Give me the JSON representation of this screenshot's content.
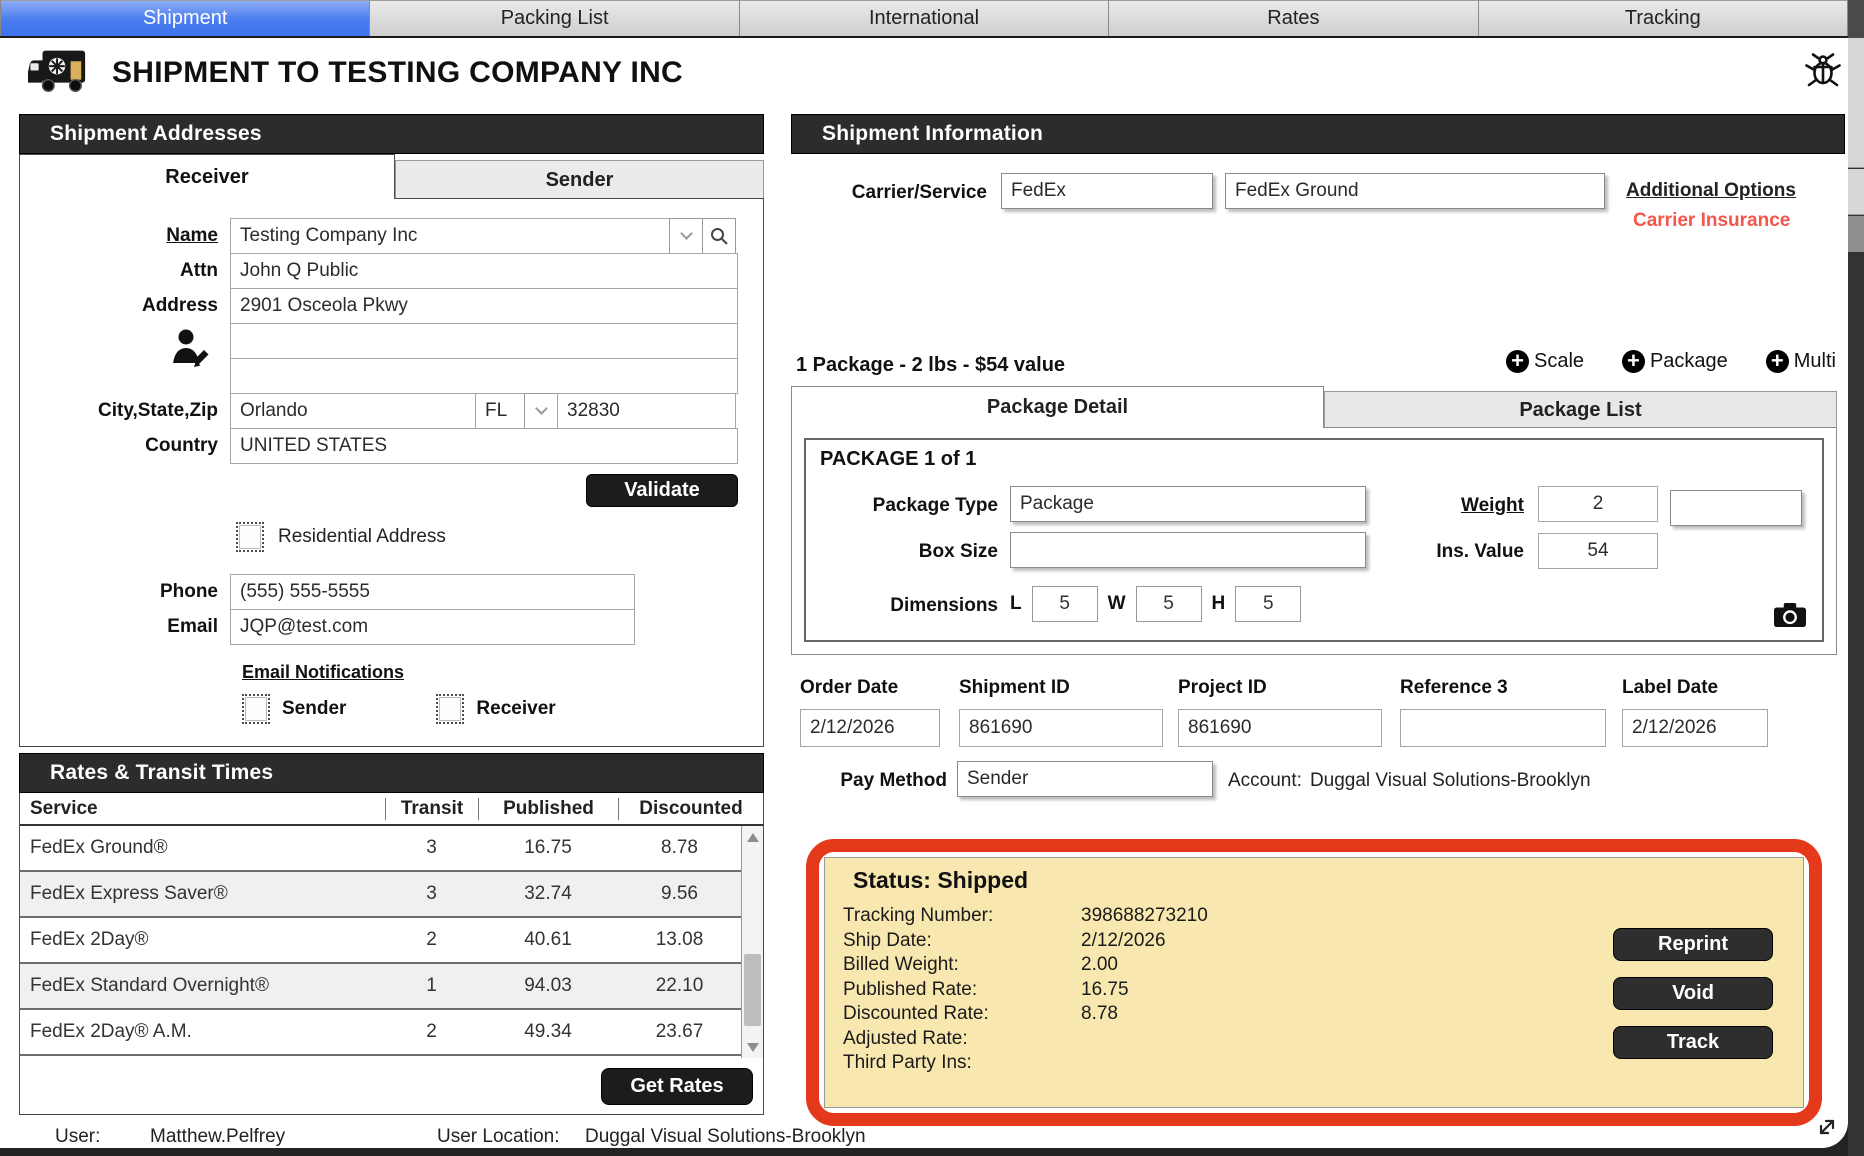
{
  "tab_bar": {
    "items": [
      "Shipment",
      "Packing List",
      "International",
      "Rates",
      "Tracking"
    ]
  },
  "header": {
    "title": "SHIPMENT TO TESTING COMPANY INC"
  },
  "addresses": {
    "title": "Shipment Addresses",
    "receiver_tab": "Receiver",
    "sender_tab": "Sender",
    "name_label": "Name",
    "name": "Testing Company Inc",
    "attn_label": "Attn",
    "attn": "John Q Public",
    "address_label": "Address",
    "address_line1": "2901 Osceola Pkwy",
    "address_line2": "",
    "address_line3": "",
    "city_state_zip_label": "City,State,Zip",
    "city": "Orlando",
    "state": "FL",
    "zip": "32830",
    "country_label": "Country",
    "country": "UNITED STATES",
    "validate_button": "Validate",
    "residential_checkbox_label": "Residential Address",
    "phone_label": "Phone",
    "phone": "(555) 555-5555",
    "email_label": "Email",
    "email": "JQP@test.com",
    "email_notifications_label": "Email Notifications",
    "notify_sender_label": "Sender",
    "notify_receiver_label": "Receiver"
  },
  "rates": {
    "title": "Rates & Transit Times",
    "columns": [
      "Service",
      "Transit",
      "Published",
      "Discounted"
    ],
    "rows": [
      [
        "FedEx Ground®",
        "3",
        "16.75",
        "8.78"
      ],
      [
        "FedEx Express Saver®",
        "3",
        "32.74",
        "9.56"
      ],
      [
        "FedEx 2Day®",
        "2",
        "40.61",
        "13.08"
      ],
      [
        "FedEx Standard Overnight®",
        "1",
        "94.03",
        "22.10"
      ],
      [
        "FedEx 2Day® A.M.",
        "2",
        "49.34",
        "23.67"
      ]
    ],
    "get_rates_button": "Get Rates"
  },
  "shipment_info": {
    "title": "Shipment Information",
    "carrier_service_label": "Carrier/Service",
    "carrier": "FedEx",
    "service": "FedEx Ground",
    "additional_options_link": "Additional Options",
    "carrier_insurance_link": "Carrier Insurance",
    "package_summary": "1 Package - 2 lbs - $54 value",
    "scale_button": "Scale",
    "package_button": "Package",
    "multi_button": "Multi",
    "package_detail_tab": "Package Detail",
    "package_list_tab": "Package List",
    "package_header": "PACKAGE 1 of 1",
    "package_type_label": "Package Type",
    "package_type": "Package",
    "box_size_label": "Box Size",
    "box_size": "",
    "dimensions_label": "Dimensions",
    "dim_l_label": "L",
    "dim_l": "5",
    "dim_w_label": "W",
    "dim_w": "5",
    "dim_h_label": "H",
    "dim_h": "5",
    "weight_label": "Weight",
    "weight": "2",
    "weight_unit": "",
    "ins_value_label": "Ins. Value",
    "ins_value": "54",
    "order_date_label": "Order Date",
    "order_date": "2/12/2026",
    "shipment_id_label": "Shipment ID",
    "shipment_id": "861690",
    "project_id_label": "Project ID",
    "project_id": "861690",
    "reference3_label": "Reference 3",
    "reference3": "",
    "label_date_label": "Label Date",
    "label_date": "2/12/2026",
    "pay_method_label": "Pay Method",
    "pay_method": "Sender",
    "account_label": "Account:",
    "account": "Duggal Visual Solutions-Brooklyn"
  },
  "status": {
    "title": "Status: Shipped",
    "rows": [
      {
        "label": "Tracking Number:",
        "value": "398688273210"
      },
      {
        "label": "Ship Date:",
        "value": "2/12/2026"
      },
      {
        "label": "Billed Weight:",
        "value": "2.00"
      },
      {
        "label": "Published Rate:",
        "value": "16.75"
      },
      {
        "label": "Discounted Rate:",
        "value": "8.78"
      },
      {
        "label": "Adjusted Rate:",
        "value": ""
      },
      {
        "label": "Third Party Ins:",
        "value": ""
      }
    ],
    "reprint_button": "Reprint",
    "void_button": "Void",
    "track_button": "Track",
    "colors": {
      "border": "#e5391c",
      "background": "#f8e8af"
    }
  },
  "footer": {
    "user_label": "User:",
    "user": "Matthew.Pelfrey",
    "location_label": "User Location:",
    "location": "Duggal Visual Solutions-Brooklyn"
  },
  "colors": {
    "active_tab_blue": "#4b7cef",
    "bar_dark": "#2c2c2c",
    "alert_red": "#e5391c",
    "insurance_red": "#f4564a",
    "status_yellow": "#f8e8af"
  }
}
